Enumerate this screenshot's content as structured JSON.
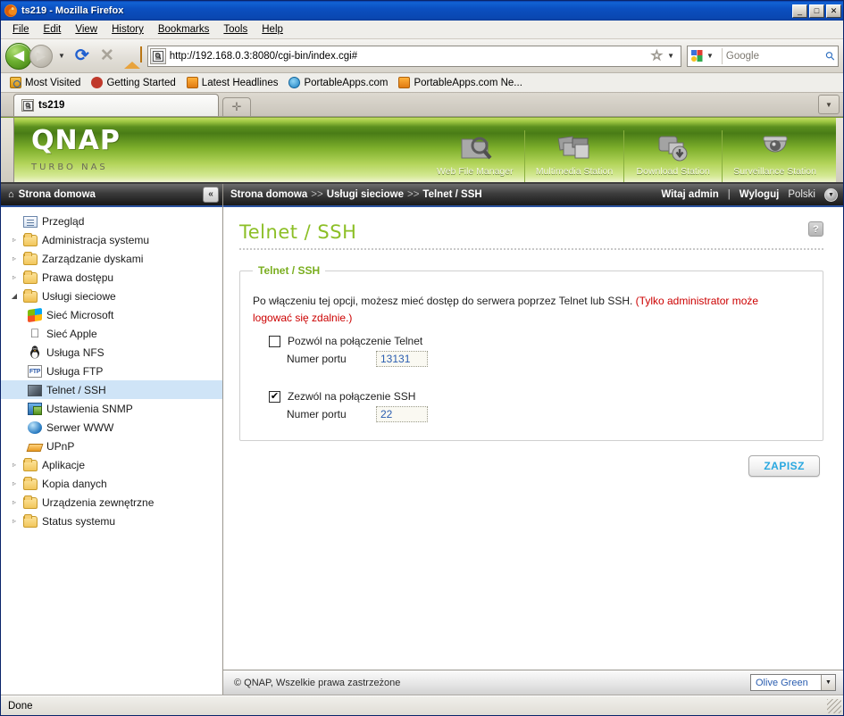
{
  "window": {
    "title": "ts219 - Mozilla Firefox",
    "minimize": "_",
    "maximize": "□",
    "close": "✕"
  },
  "menubar": {
    "items": [
      {
        "label": "File"
      },
      {
        "label": "Edit"
      },
      {
        "label": "View"
      },
      {
        "label": "History"
      },
      {
        "label": "Bookmarks"
      },
      {
        "label": "Tools"
      },
      {
        "label": "Help"
      }
    ]
  },
  "navbar": {
    "back_glyph": "◀",
    "forward_glyph": "▶",
    "dropdown_glyph": "▼",
    "reload_glyph": "⟳",
    "stop_glyph": "✕",
    "url": "http://192.168.0.3:8080/cgi-bin/index.cgi#",
    "star_glyph": "☆",
    "search_placeholder": "Google",
    "search_engine": "Google",
    "magnifier_glyph": "⚲"
  },
  "bookmarks": {
    "items": [
      {
        "label": "Most Visited",
        "icon": "most-visited-icon"
      },
      {
        "label": "Getting Started",
        "icon": "getting-started-icon"
      },
      {
        "label": "Latest Headlines",
        "icon": "rss-icon"
      },
      {
        "label": "PortableApps.com",
        "icon": "portableapps-icon"
      },
      {
        "label": "PortableApps.com Ne...",
        "icon": "rss-icon"
      }
    ]
  },
  "tabs": {
    "active": "ts219",
    "new_tab_glyph": "✛",
    "tab_list_glyph": "▼"
  },
  "qnap_header": {
    "logo": "QNAP",
    "subtitle": "TURBO NAS",
    "apps": [
      {
        "label": "Web File Manager",
        "icon": "web-file-manager-icon"
      },
      {
        "label": "Multimedia Station",
        "icon": "multimedia-station-icon"
      },
      {
        "label": "Download Station",
        "icon": "download-station-icon"
      },
      {
        "label": "Surveillance Station",
        "icon": "surveillance-station-icon"
      }
    ]
  },
  "sidebar": {
    "header": "Strona domowa",
    "home_glyph": "⌂",
    "collapse_glyph": "«",
    "items": [
      {
        "label": "Przegląd",
        "icon": "overview-icon",
        "level": 1,
        "twisty": "none",
        "selected": false
      },
      {
        "label": "Administracja systemu",
        "icon": "folder-icon",
        "level": 1,
        "twisty": "closed",
        "selected": false
      },
      {
        "label": "Zarządzanie dyskami",
        "icon": "folder-icon",
        "level": 1,
        "twisty": "closed",
        "selected": false
      },
      {
        "label": "Prawa dostępu",
        "icon": "folder-icon",
        "level": 1,
        "twisty": "closed",
        "selected": false
      },
      {
        "label": "Usługi sieciowe",
        "icon": "folder-open-icon",
        "level": 1,
        "twisty": "open",
        "selected": false
      },
      {
        "label": "Sieć Microsoft",
        "icon": "microsoft-icon",
        "level": 2,
        "twisty": "none",
        "selected": false
      },
      {
        "label": "Sieć Apple",
        "icon": "apple-icon",
        "level": 2,
        "twisty": "none",
        "selected": false
      },
      {
        "label": "Usługa NFS",
        "icon": "linux-icon",
        "level": 2,
        "twisty": "none",
        "selected": false
      },
      {
        "label": "Usługa FTP",
        "icon": "ftp-icon",
        "level": 2,
        "twisty": "none",
        "selected": false
      },
      {
        "label": "Telnet / SSH",
        "icon": "telnet-icon",
        "level": 2,
        "twisty": "none",
        "selected": true
      },
      {
        "label": "Ustawienia SNMP",
        "icon": "snmp-icon",
        "level": 2,
        "twisty": "none",
        "selected": false
      },
      {
        "label": "Serwer WWW",
        "icon": "www-icon",
        "level": 2,
        "twisty": "none",
        "selected": false
      },
      {
        "label": "UPnP",
        "icon": "upnp-icon",
        "level": 2,
        "twisty": "none",
        "selected": false
      },
      {
        "label": "Aplikacje",
        "icon": "folder-icon",
        "level": 1,
        "twisty": "closed",
        "selected": false
      },
      {
        "label": "Kopia danych",
        "icon": "folder-icon",
        "level": 1,
        "twisty": "closed",
        "selected": false
      },
      {
        "label": "Urządzenia zewnętrzne",
        "icon": "folder-icon",
        "level": 1,
        "twisty": "closed",
        "selected": false
      },
      {
        "label": "Status systemu",
        "icon": "folder-icon",
        "level": 1,
        "twisty": "closed",
        "selected": false
      }
    ]
  },
  "breadcrumb": {
    "parts": [
      "Strona domowa",
      "Usługi sieciowe",
      "Telnet / SSH"
    ],
    "separator": ">>",
    "greeting": "Witaj admin",
    "pipe": "|",
    "logout": "Wyloguj",
    "language": "Polski",
    "language_arrow": "▼"
  },
  "page": {
    "title": "Telnet / SSH",
    "help_glyph": "?",
    "group_legend": "Telnet / SSH",
    "description_normal": "Po włączeniu tej opcji, możesz mieć dostęp do serwera poprzez Telnet lub SSH.",
    "description_warning": "(Tylko administrator może logować się zdalnie.)",
    "telnet": {
      "checkbox_label": "Pozwól na połączenie Telnet",
      "checked": false,
      "check_glyph": "",
      "port_label": "Numer portu",
      "port_value": "13131"
    },
    "ssh": {
      "checkbox_label": "Zezwól na połączenie SSH",
      "checked": true,
      "check_glyph": "✔",
      "port_label": "Numer portu",
      "port_value": "22"
    },
    "save_label": "ZAPISZ"
  },
  "qnap_footer": {
    "copyright": "© QNAP, Wszelkie prawa zastrzeżone",
    "theme": "Olive Green",
    "theme_arrow": "▼"
  },
  "statusbar": {
    "text": "Done"
  },
  "colors": {
    "accent_green": "#8cbf26",
    "banner_dark_green": "#497c16",
    "warning_red": "#cc0000",
    "link_blue": "#2a5db0",
    "save_text_blue": "#29a8e0",
    "selection_blue": "#cfe4f7",
    "titlebar_blue": "#0b4fc0"
  }
}
